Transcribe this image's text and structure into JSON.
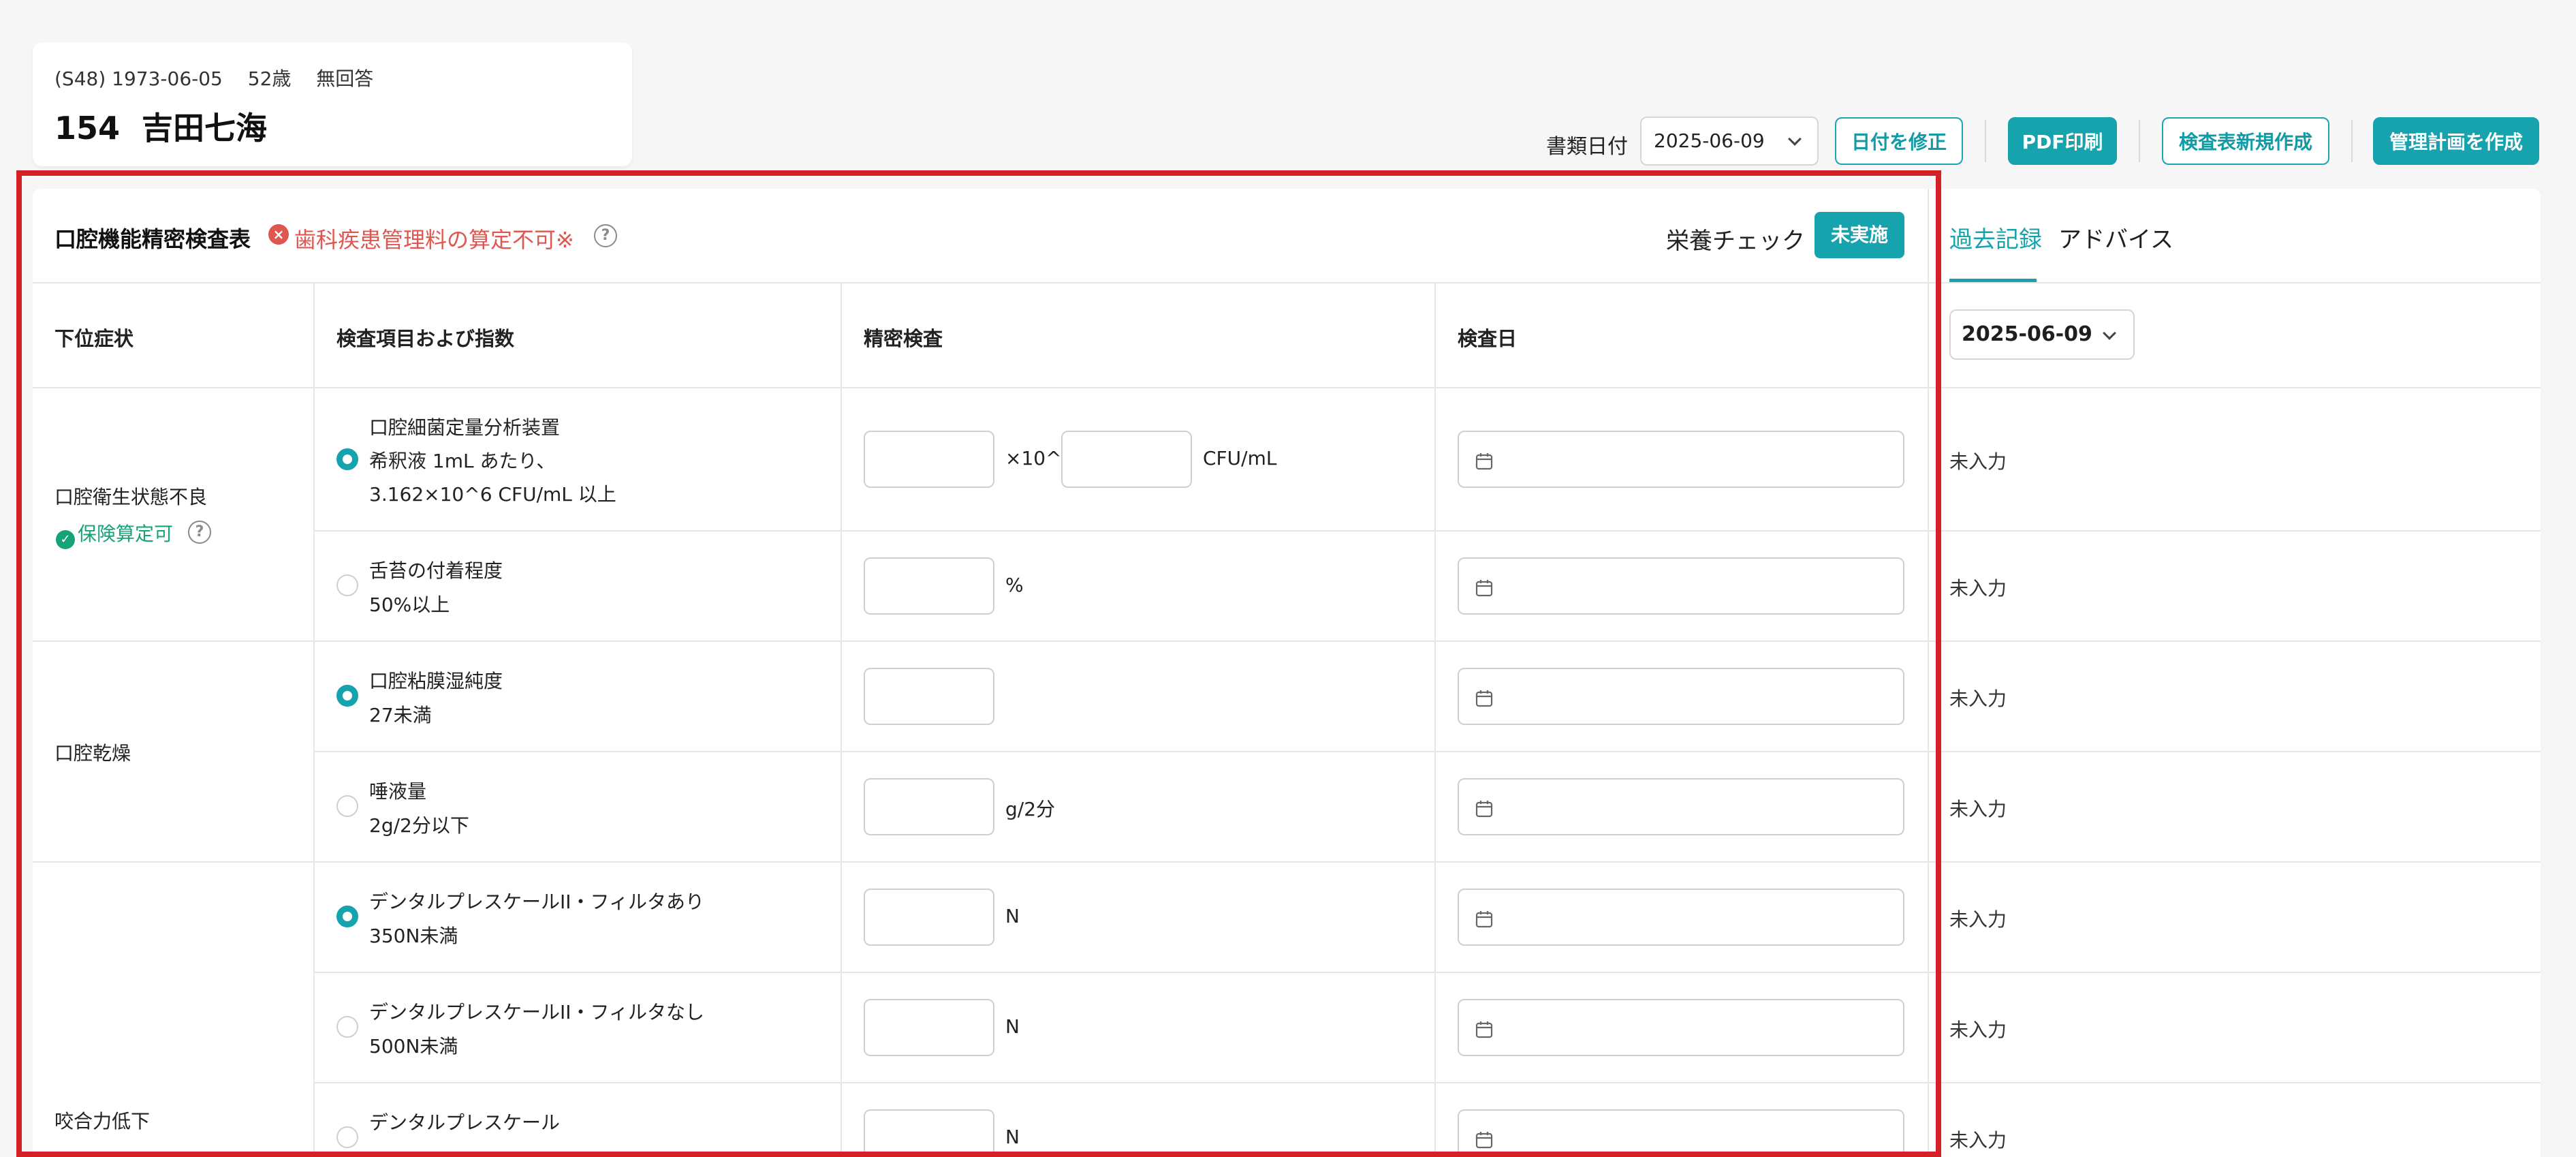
{
  "patient": {
    "meta": "(S48) 1973-06-05　 52歳　 無回答",
    "name": "154  吉田七海"
  },
  "toolbar": {
    "doc_date_label": "書類日付",
    "doc_date_value": "2025-06-09",
    "fix_date_button": "日付を修正",
    "pdf_button": "PDF印刷",
    "new_sheet_button": "検査表新規作成",
    "plan_button": "管理計画を作成"
  },
  "panel": {
    "title": "口腔機能精密検査表",
    "warning": "歯科疾患管理料の算定不可※",
    "nutrition_label": "栄養チェック",
    "nutrition_badge": "未実施"
  },
  "tabs": {
    "history": "過去記録",
    "advice": "アドバイス"
  },
  "table": {
    "headers": [
      "下位症状",
      "検査項目および指数",
      "精密検査",
      "検査日"
    ],
    "history_date": "2025-06-09",
    "groups": [
      {
        "symptom": "口腔衛生状態不良",
        "badge": "保険算定可"
      },
      {
        "symptom": "口腔乾燥",
        "badge": ""
      },
      {
        "symptom": "咬合力低下",
        "badge": ""
      }
    ],
    "rows": [
      {
        "selected": true,
        "lines": [
          "口腔細菌定量分析装置",
          "希釈液 1mL あたり、",
          "3.162×10^6 CFU/mL 以上"
        ],
        "unit1": "×10^",
        "unit2": "CFU/mL",
        "status": "未入力"
      },
      {
        "selected": false,
        "lines": [
          "舌苔の付着程度",
          "50%以上"
        ],
        "unit1": "%",
        "status": "未入力"
      },
      {
        "selected": true,
        "lines": [
          "口腔粘膜湿純度",
          "27未満"
        ],
        "unit1": "",
        "status": "未入力"
      },
      {
        "selected": false,
        "lines": [
          "唾液量",
          "2g/2分以下"
        ],
        "unit1": "g/2分",
        "status": "未入力"
      },
      {
        "selected": true,
        "lines": [
          "デンタルプレスケールII・フィルタあり",
          "350N未満"
        ],
        "unit1": "N",
        "status": "未入力"
      },
      {
        "selected": false,
        "lines": [
          "デンタルプレスケールII・フィルタなし",
          "500N未満"
        ],
        "unit1": "N",
        "status": "未入力"
      },
      {
        "selected": false,
        "lines": [
          "デンタルプレスケール",
          ""
        ],
        "unit1": "N",
        "status": "未入力"
      }
    ]
  },
  "colors": {
    "accent": "#17a3ae",
    "warning": "#e0574f",
    "success": "#16a37a",
    "highlight": "#d42027"
  },
  "icons": {
    "warning": "x-circle-icon",
    "help": "question-circle-icon",
    "ok": "check-circle-icon",
    "calendar": "calendar-icon",
    "chevron": "chevron-down-icon"
  }
}
